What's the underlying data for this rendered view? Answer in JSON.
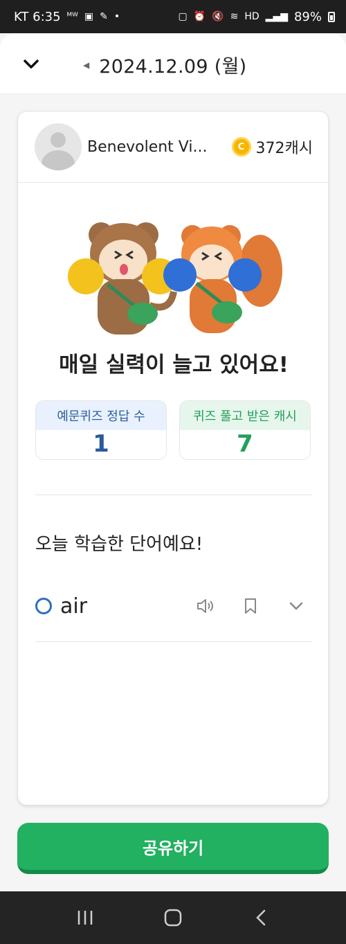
{
  "status_bar": {
    "carrier_time": "KT 6:35",
    "battery": "89%"
  },
  "header": {
    "date": "2024.12.09 (월)"
  },
  "profile": {
    "name": "Benevolent Vi...",
    "cash": "372캐시"
  },
  "headline": "매일 실력이 늘고 있어요!",
  "stats": [
    {
      "label": "예문퀴즈 정답 수",
      "value": "1"
    },
    {
      "label": "퀴즈 풀고 받은 캐시",
      "value": "7"
    }
  ],
  "section_title": "오늘 학습한 단어예요!",
  "words": [
    {
      "word": "air"
    }
  ],
  "share_button": "공유하기",
  "colors": {
    "accent_green": "#22b061",
    "accent_blue": "#2a5a9c"
  }
}
